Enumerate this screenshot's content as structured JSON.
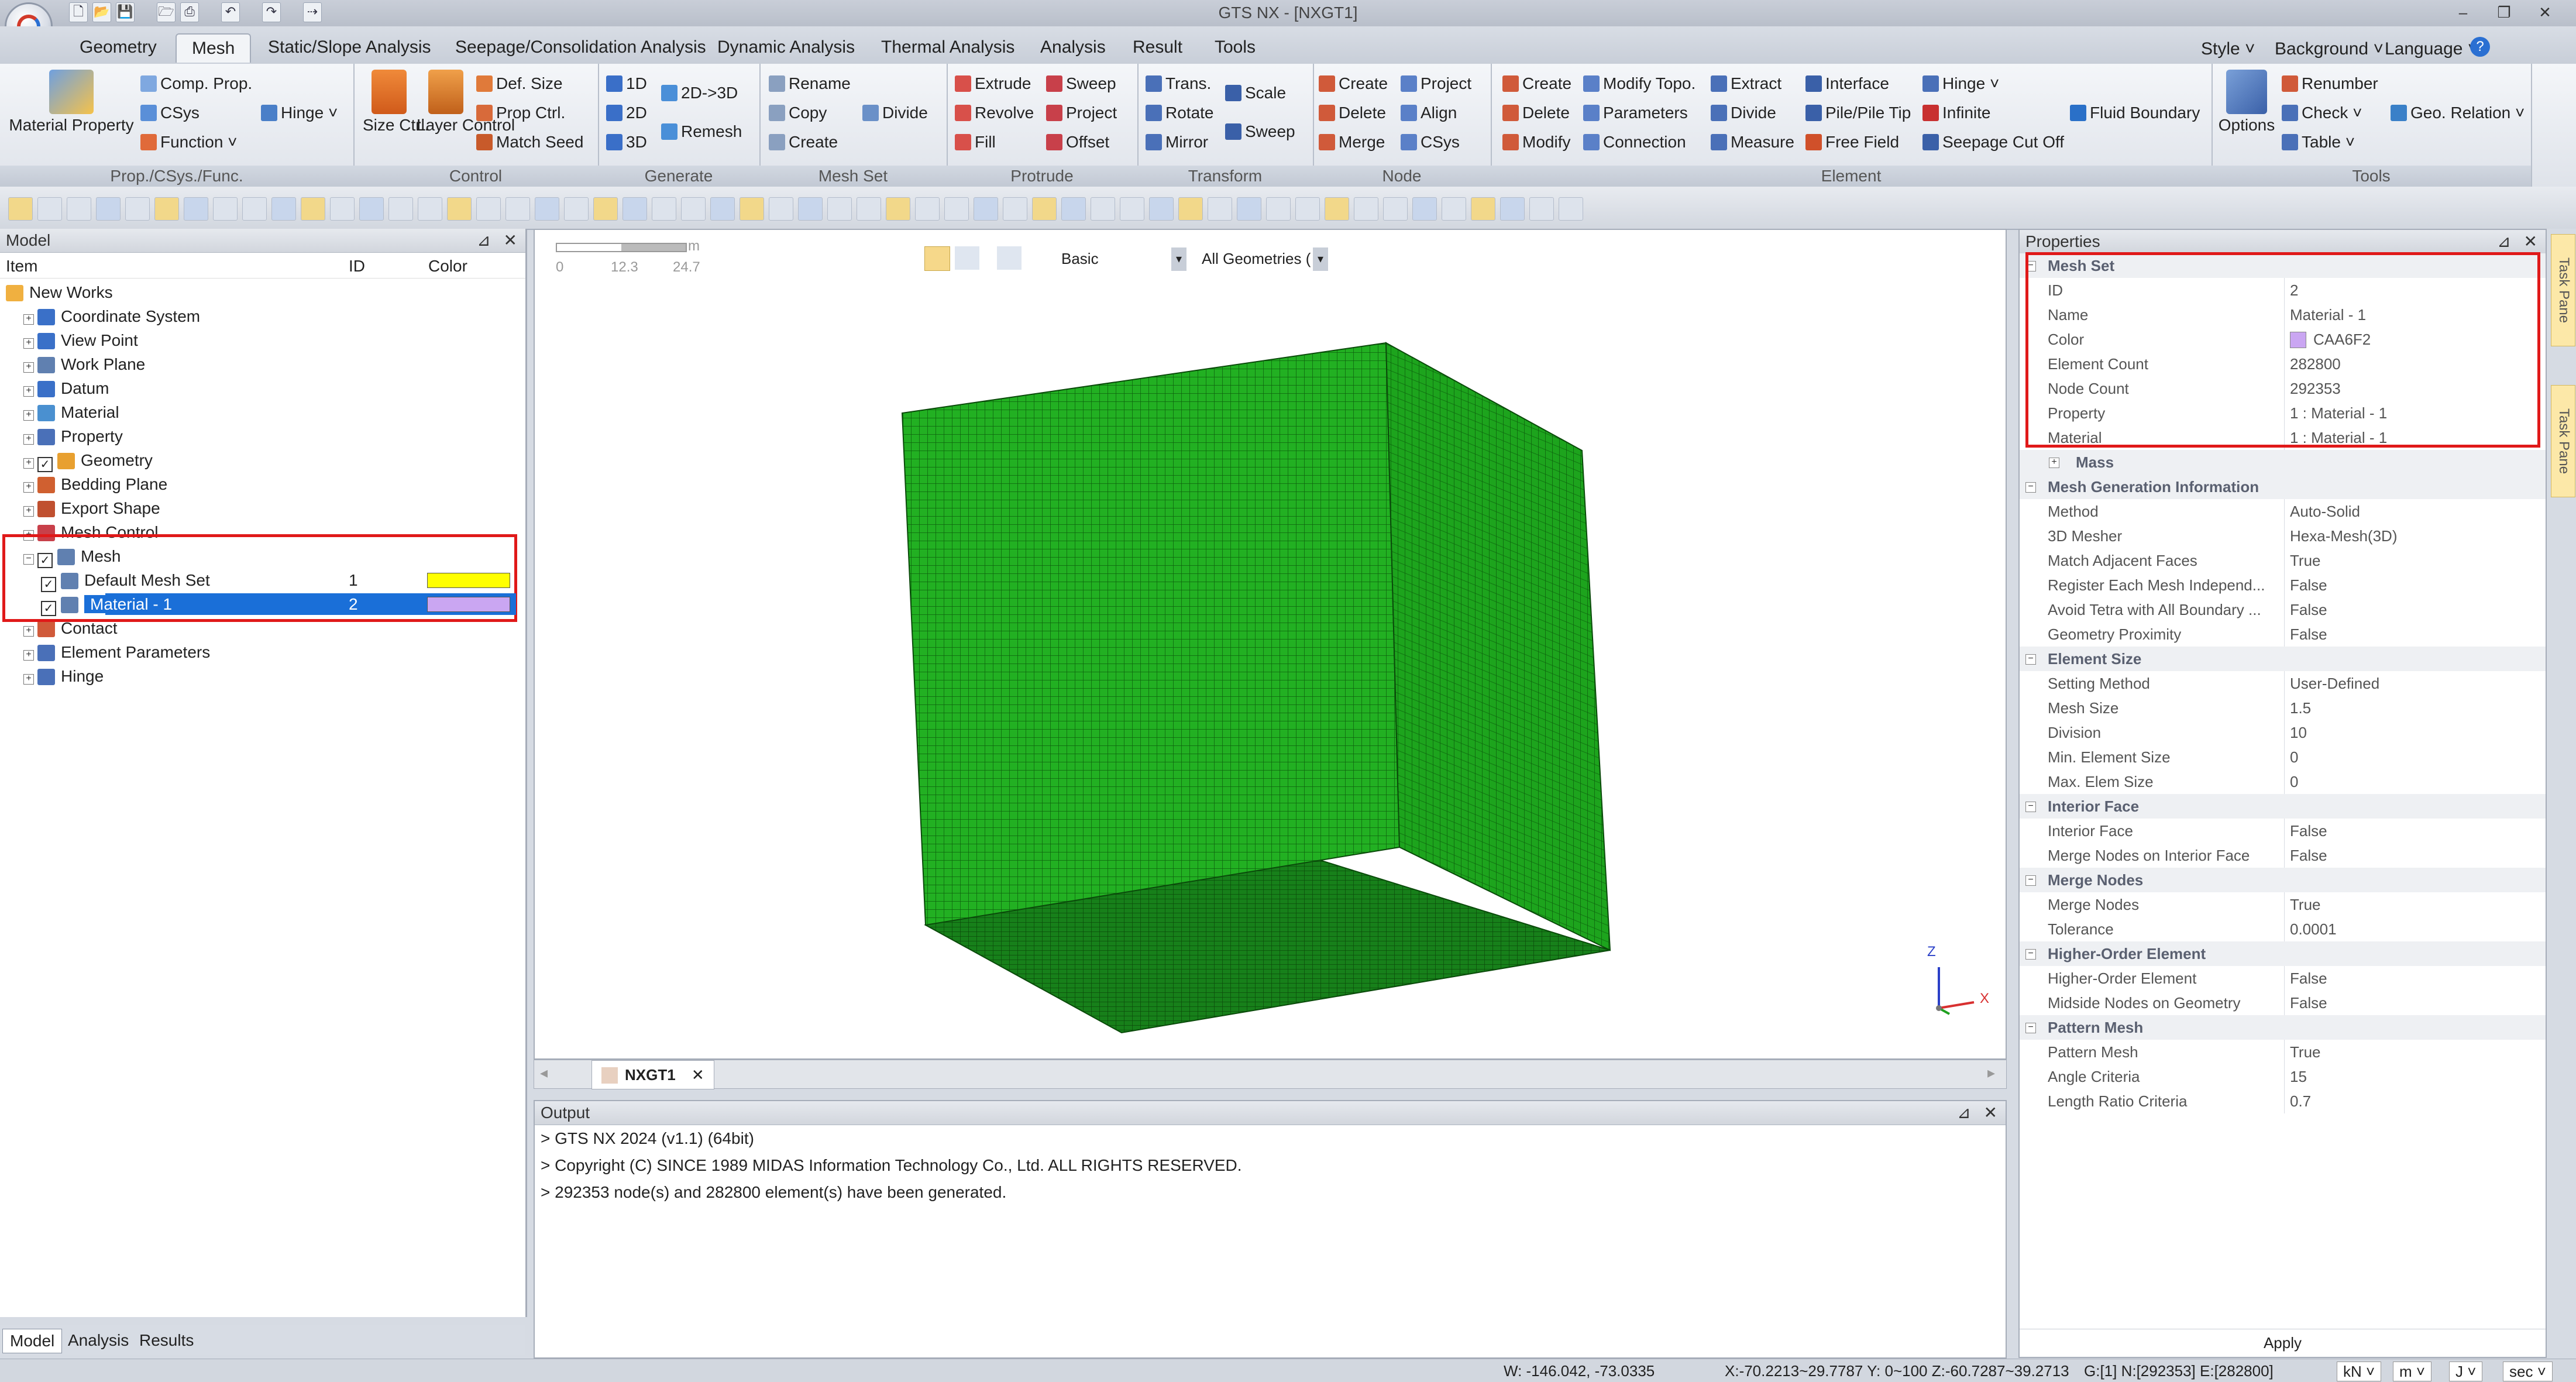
{
  "window": {
    "title": "GTS NX - [NXGT1]"
  },
  "menu_tabs": [
    "Geometry",
    "Mesh",
    "Static/Slope Analysis",
    "Seepage/Consolidation Analysis",
    "Dynamic Analysis",
    "Thermal Analysis",
    "Analysis",
    "Result",
    "Tools"
  ],
  "menu_right": {
    "style": "Style",
    "background": "Background",
    "language": "Language"
  },
  "ribbon": {
    "prop": {
      "material_property": "Material Property",
      "comp_prop": "Comp. Prop.",
      "csys": "CSys",
      "function": "Function",
      "hinge": "Hinge",
      "label": "Prop./CSys./Func."
    },
    "control": {
      "size_ctrl": "Size Ctrl.",
      "layer_control": "Layer Control",
      "def_size": "Def. Size",
      "prop_ctrl": "Prop Ctrl.",
      "match_seed": "Match Seed",
      "label": "Control"
    },
    "generate": {
      "d1": "1D",
      "d2": "2D",
      "d3": "3D",
      "d2to3": "2D->3D",
      "remesh": "Remesh",
      "label": "Generate"
    },
    "meshset": {
      "rename": "Rename",
      "copy": "Copy",
      "create": "Create",
      "divide": "Divide",
      "label": "Mesh Set"
    },
    "protrude": {
      "extrude": "Extrude",
      "revolve": "Revolve",
      "fill": "Fill",
      "sweep": "Sweep",
      "project": "Project",
      "offset": "Offset",
      "label": "Protrude"
    },
    "transform": {
      "trans": "Trans.",
      "rotate": "Rotate",
      "mirror": "Mirror",
      "scale": "Scale",
      "sweep": "Sweep",
      "label": "Transform"
    },
    "node": {
      "create": "Create",
      "delete": "Delete",
      "merge": "Merge",
      "project": "Project",
      "align": "Align",
      "csys": "CSys",
      "label": "Node"
    },
    "element": {
      "create": "Create",
      "delete": "Delete",
      "modify": "Modify",
      "modify_topo": "Modify Topo.",
      "parameters": "Parameters",
      "connection": "Connection",
      "extract": "Extract",
      "divide": "Divide",
      "measure": "Measure",
      "interface": "Interface",
      "pile": "Pile/Pile Tip",
      "free_field": "Free Field",
      "hinge": "Hinge",
      "infinite": "Infinite",
      "seepage_cutoff": "Seepage Cut Off",
      "fluid_boundary": "Fluid Boundary",
      "label": "Element"
    },
    "tools": {
      "options": "Options",
      "renumber": "Renumber",
      "check": "Check",
      "table": "Table",
      "geo_relation": "Geo. Relation",
      "label": "Tools"
    }
  },
  "model_panel": {
    "title": "Model",
    "columns": {
      "item": "Item",
      "id": "ID",
      "color": "Color"
    },
    "tree": [
      {
        "label": "New Works",
        "level": 0
      },
      {
        "label": "Coordinate System",
        "level": 1
      },
      {
        "label": "View Point",
        "level": 1
      },
      {
        "label": "Work Plane",
        "level": 1
      },
      {
        "label": "Datum",
        "level": 1
      },
      {
        "label": "Material",
        "level": 1
      },
      {
        "label": "Property",
        "level": 1
      },
      {
        "label": "Geometry",
        "level": 1
      },
      {
        "label": "Bedding Plane",
        "level": 1
      },
      {
        "label": "Export Shape",
        "level": 1
      },
      {
        "label": "Mesh Control",
        "level": 1
      },
      {
        "label": "Mesh",
        "level": 1
      },
      {
        "label": "Default Mesh Set",
        "level": 2,
        "id": "1",
        "color": "#FFFF00"
      },
      {
        "label": "Material - 1",
        "level": 2,
        "id": "2",
        "color": "#CAA6F2"
      },
      {
        "label": "Contact",
        "level": 1
      },
      {
        "label": "Element Parameters",
        "level": 1
      },
      {
        "label": "Hinge",
        "level": 1
      }
    ],
    "bottom_tabs": [
      "Model",
      "Analysis",
      "Results"
    ]
  },
  "viewport": {
    "scale_labels": [
      "0",
      "12.3",
      "24.7"
    ],
    "scale_unit": "m",
    "view_mode": "Basic",
    "filter": "All Geometries (",
    "axes": {
      "z": "Z",
      "x": "X"
    },
    "mesh_color": "#1ea61e",
    "doc_tab": "NXGT1"
  },
  "output": {
    "title": "Output",
    "lines": [
      "> GTS NX 2024 (v1.1) (64bit)",
      "> Copyright (C) SINCE 1989 MIDAS Information Technology Co., Ltd. ALL RIGHTS RESERVED.",
      "> 292353 node(s) and 282800 element(s) have been generated."
    ]
  },
  "properties": {
    "title": "Properties",
    "rows": [
      {
        "type": "cat",
        "key": "Mesh Set"
      },
      {
        "key": "ID",
        "value": "2"
      },
      {
        "key": "Name",
        "value": "Material - 1"
      },
      {
        "key": "Color",
        "value": "CAA6F2",
        "swatch": "#CAA6F2"
      },
      {
        "key": "Element Count",
        "value": "282800"
      },
      {
        "key": "Node Count",
        "value": "292353"
      },
      {
        "key": "Property",
        "value": "1 : Material - 1"
      },
      {
        "key": "Material",
        "value": "1 : Material - 1"
      },
      {
        "type": "cat",
        "key": "Mass",
        "collapsed": true
      },
      {
        "type": "cat",
        "key": "Mesh Generation Information"
      },
      {
        "key": "Method",
        "value": "Auto-Solid"
      },
      {
        "key": "3D Mesher",
        "value": "Hexa-Mesh(3D)"
      },
      {
        "key": "Match Adjacent Faces",
        "value": "True"
      },
      {
        "key": "Register Each Mesh Independ...",
        "value": "False"
      },
      {
        "key": "Avoid Tetra with All Boundary ...",
        "value": "False"
      },
      {
        "key": "Geometry Proximity",
        "value": "False"
      },
      {
        "type": "cat",
        "key": "Element Size"
      },
      {
        "key": "Setting Method",
        "value": "User-Defined"
      },
      {
        "key": "Mesh Size",
        "value": "1.5"
      },
      {
        "key": "Division",
        "value": "10"
      },
      {
        "key": "Min. Element Size",
        "value": "0"
      },
      {
        "key": "Max. Elem Size",
        "value": "0"
      },
      {
        "type": "cat",
        "key": "Interior Face"
      },
      {
        "key": "Interior Face",
        "value": "False"
      },
      {
        "key": "Merge Nodes on Interior Face",
        "value": "False"
      },
      {
        "type": "cat",
        "key": "Merge Nodes"
      },
      {
        "key": "Merge Nodes",
        "value": "True"
      },
      {
        "key": "Tolerance",
        "value": "0.0001"
      },
      {
        "type": "cat",
        "key": "Higher-Order Element"
      },
      {
        "key": "Higher-Order Element",
        "value": "False"
      },
      {
        "key": "Midside Nodes on Geometry",
        "value": "False"
      },
      {
        "type": "cat",
        "key": "Pattern Mesh"
      },
      {
        "key": "Pattern Mesh",
        "value": "True"
      },
      {
        "key": "Angle Criteria",
        "value": "15"
      },
      {
        "key": "Length Ratio Criteria",
        "value": "0.7"
      }
    ],
    "apply": "Apply"
  },
  "task_pane": [
    "Task Pane",
    "Task Pane"
  ],
  "status": {
    "w": "W: -146.042, -73.0335",
    "xyz": "X:-70.2213~29.7787 Y: 0~100 Z:-60.7287~39.2713",
    "counts": "G:[1] N:[292353] E:[282800]",
    "units": [
      "kN",
      "m",
      "J",
      "sec"
    ]
  }
}
